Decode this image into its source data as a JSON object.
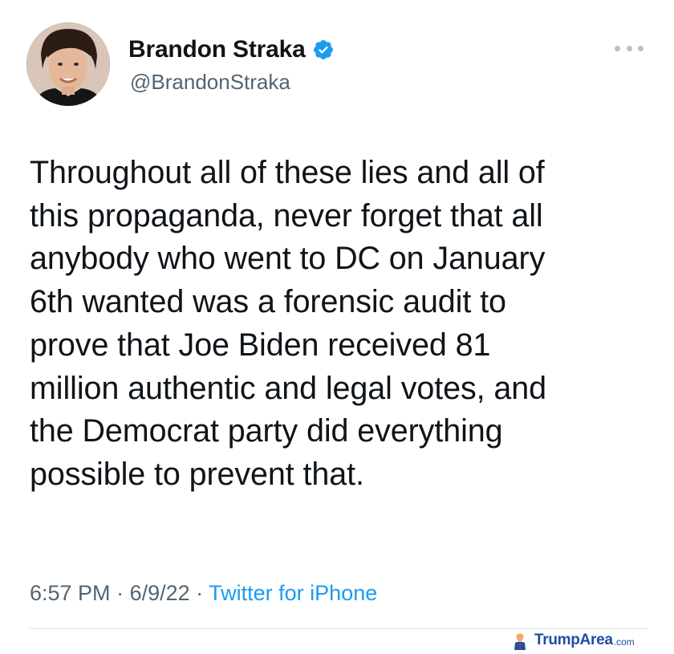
{
  "author": {
    "display_name": "Brandon Straka",
    "handle": "@BrandonStraka",
    "verified_icon": "verified-badge-icon",
    "avatar_icon": "avatar"
  },
  "tweet": {
    "lines": [
      "Throughout all of these lies and all of",
      "this propaganda, never forget that all",
      "anybody who went to DC on January",
      "6th wanted was a forensic audit to",
      "prove that Joe Biden received 81",
      "million authentic and legal votes, and",
      "the Democrat party did everything",
      "possible to prevent that."
    ]
  },
  "meta": {
    "time": "6:57 PM",
    "separator": " · ",
    "date": "6/9/22",
    "source": "Twitter for iPhone"
  },
  "watermark": {
    "text": "TrumpArea",
    "domain": ".com"
  },
  "colors": {
    "accent": "#1d9bf0",
    "secondary_text": "#536471",
    "primary_text": "#0f1419",
    "watermark": "#1e4fa0"
  }
}
